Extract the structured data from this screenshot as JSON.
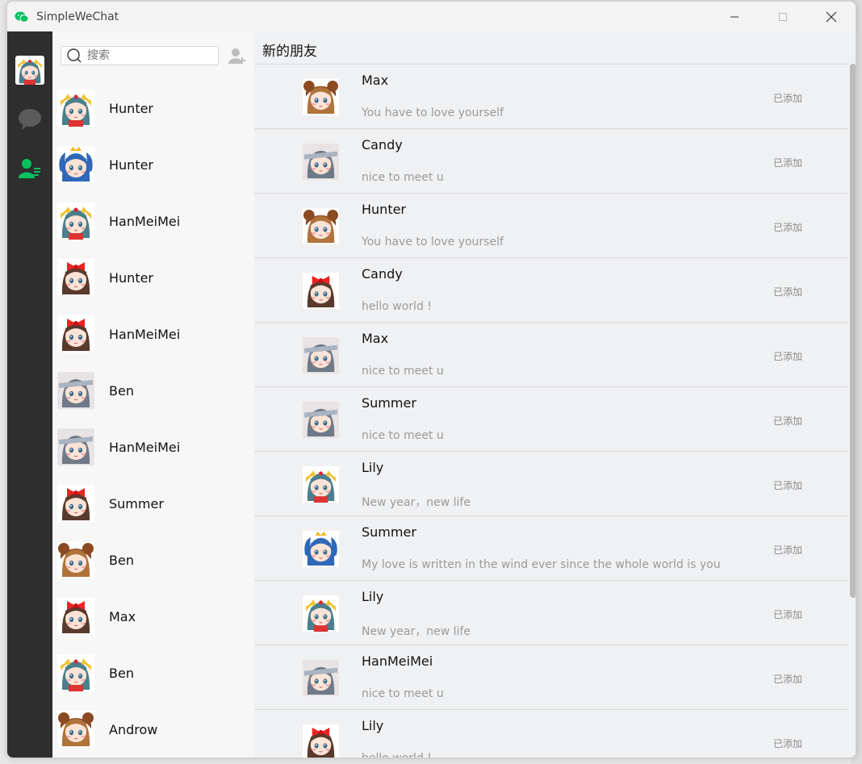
{
  "window": {
    "title": "SimpleWeChat"
  },
  "colors": {
    "accent": "#07c160",
    "nav_bg": "#2e2e2e",
    "contacts_bg": "#f7f7f7",
    "main_bg": "#f0f1f3"
  },
  "nav": {
    "items": [
      {
        "icon": "user-avatar",
        "active": false
      },
      {
        "icon": "chat-bubble-icon",
        "active": false
      },
      {
        "icon": "contacts-icon",
        "active": true
      }
    ]
  },
  "search": {
    "placeholder": "搜索",
    "value": ""
  },
  "contacts": [
    {
      "name": "Hunter",
      "avatar": "tiger"
    },
    {
      "name": "Hunter",
      "avatar": "blue"
    },
    {
      "name": "HanMeiMei",
      "avatar": "tiger"
    },
    {
      "name": "Hunter",
      "avatar": "bow"
    },
    {
      "name": "HanMeiMei",
      "avatar": "bow"
    },
    {
      "name": "Ben",
      "avatar": "gray"
    },
    {
      "name": "HanMeiMei",
      "avatar": "gray"
    },
    {
      "name": "Summer",
      "avatar": "bow"
    },
    {
      "name": "Ben",
      "avatar": "bear"
    },
    {
      "name": "Max",
      "avatar": "bow"
    },
    {
      "name": "Ben",
      "avatar": "tiger"
    },
    {
      "name": "Androw",
      "avatar": "bear"
    }
  ],
  "main": {
    "title": "新的朋友",
    "requests": [
      {
        "name": "Max",
        "message": "You have to love yourself",
        "status": "已添加",
        "avatar": "bear"
      },
      {
        "name": "Candy",
        "message": "nice to meet u",
        "status": "已添加",
        "avatar": "gray"
      },
      {
        "name": "Hunter",
        "message": "You have to love yourself",
        "status": "已添加",
        "avatar": "bear"
      },
      {
        "name": "Candy",
        "message": "hello world !",
        "status": "已添加",
        "avatar": "bow"
      },
      {
        "name": "Max",
        "message": "nice to meet u",
        "status": "已添加",
        "avatar": "gray"
      },
      {
        "name": "Summer",
        "message": "nice to meet u",
        "status": "已添加",
        "avatar": "gray"
      },
      {
        "name": "Lily",
        "message": "New year，new life",
        "status": "已添加",
        "avatar": "tiger"
      },
      {
        "name": "Summer",
        "message": "My love is written in the wind ever since the whole world is you",
        "status": "已添加",
        "avatar": "blue"
      },
      {
        "name": "Lily",
        "message": "New year，new life",
        "status": "已添加",
        "avatar": "tiger"
      },
      {
        "name": "HanMeiMei",
        "message": "nice to meet u",
        "status": "已添加",
        "avatar": "gray"
      },
      {
        "name": "Lily",
        "message": "hello world !",
        "status": "已添加",
        "avatar": "bow"
      }
    ]
  }
}
